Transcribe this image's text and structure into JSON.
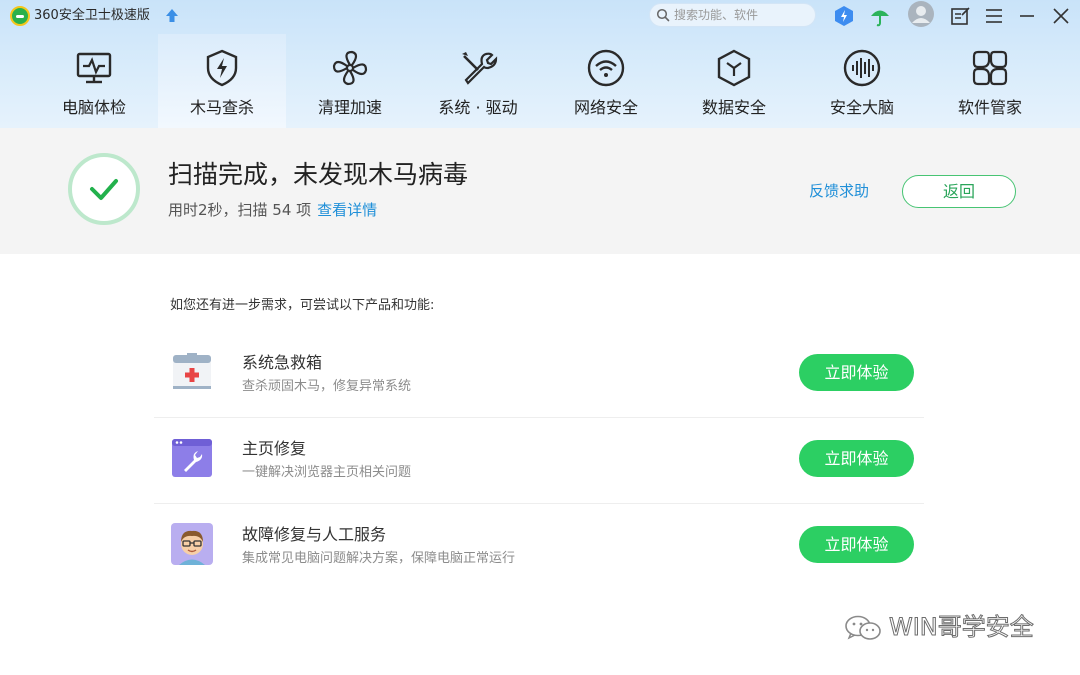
{
  "app": {
    "title": "360安全卫士极速版",
    "logo_icon": "360-logo-icon",
    "upgrade_icon": "upgrade-arrow-icon"
  },
  "search": {
    "placeholder": "搜索功能、软件"
  },
  "titlebar_icons": [
    "boost-icon",
    "umbrella-icon",
    "avatar",
    "notes-icon",
    "menu-icon",
    "minimize-icon",
    "close-icon"
  ],
  "nav": {
    "tabs": [
      {
        "label": "电脑体检",
        "icon": "monitor-pulse-icon",
        "active": false
      },
      {
        "label": "木马查杀",
        "icon": "shield-bolt-icon",
        "active": true
      },
      {
        "label": "清理加速",
        "icon": "fan-icon",
        "active": false
      },
      {
        "label": "系统 · 驱动",
        "icon": "tools-icon",
        "active": false
      },
      {
        "label": "网络安全",
        "icon": "wifi-icon",
        "active": false
      },
      {
        "label": "数据安全",
        "icon": "data-cube-icon",
        "active": false
      },
      {
        "label": "安全大脑",
        "icon": "brain-wave-icon",
        "active": false
      },
      {
        "label": "软件管家",
        "icon": "apps-icon",
        "active": false
      }
    ]
  },
  "status": {
    "title": "扫描完成，未发现木马病毒",
    "subtitle": "用时2秒，扫描 54 项",
    "details_link": "查看详情",
    "feedback": "反馈求助",
    "back": "返回",
    "accent": "#2ccf63"
  },
  "suggestions": {
    "intro": "如您还有进一步需求，可尝试以下产品和功能:",
    "items": [
      {
        "name": "系统急救箱",
        "desc": "查杀顽固木马，修复异常系统",
        "button": "立即体验",
        "icon": "first-aid-kit-icon"
      },
      {
        "name": "主页修复",
        "desc": "一键解决浏览器主页相关问题",
        "button": "立即体验",
        "icon": "browser-repair-icon"
      },
      {
        "name": "故障修复与人工服务",
        "desc": "集成常见电脑问题解决方案，保障电脑正常运行",
        "button": "立即体验",
        "icon": "support-person-icon"
      }
    ]
  },
  "watermark": {
    "text": "WIN哥学安全",
    "icon": "wechat-icon"
  }
}
